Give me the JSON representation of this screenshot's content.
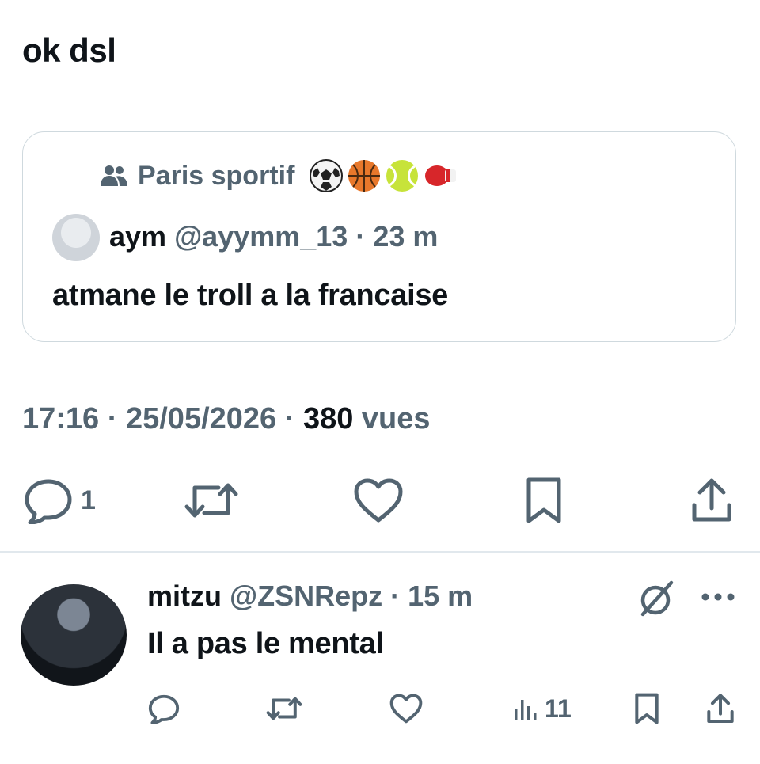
{
  "tweet": {
    "text": "ok dsl",
    "quote": {
      "community_icon": "community-icon",
      "community_name": "Paris sportif",
      "community_emojis": [
        "soccer-ball",
        "basketball",
        "tennis-ball",
        "boxing-glove"
      ],
      "author_name": "aym",
      "author_handle": "@ayymm_13",
      "time": "23 m",
      "text": "atmane le troll a la francaise"
    },
    "time": "17:16",
    "date": "25/05/2026",
    "views_count": "380",
    "views_label": "vues",
    "actions": {
      "reply_count": "1",
      "icons": [
        "reply-icon",
        "retweet-icon",
        "like-icon",
        "bookmark-icon",
        "share-icon"
      ]
    }
  },
  "reply": {
    "author_name": "mitzu",
    "author_handle": "@ZSNRepz",
    "time": "15 m",
    "text": "Il a pas le mental",
    "views_count": "11",
    "icons": [
      "reply-icon",
      "retweet-icon",
      "like-icon",
      "views-icon",
      "bookmark-icon",
      "share-icon",
      "grok-icon",
      "more-icon"
    ]
  },
  "colors": {
    "text": "#0f1419",
    "muted": "#536471",
    "border": "#cfd9de"
  }
}
